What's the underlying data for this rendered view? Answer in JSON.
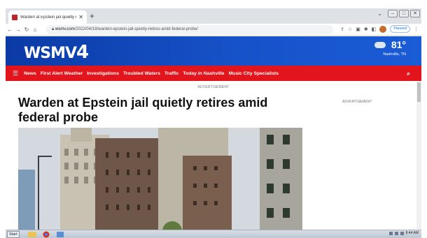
{
  "browser": {
    "tab_title": "Warden at Epstein jail quietly retire",
    "new_tab": "+",
    "url_host": "wsmv.com",
    "url_path": "/2022/04/19/warden-epstein-jail-quietly-retires-amid-federal-probe/",
    "paused_label": "Paused"
  },
  "site": {
    "logo_text": "WSMV",
    "logo_number": "4",
    "weather_temp": "81°",
    "weather_location": "Nashville, TN",
    "nav_items": [
      "News",
      "First Alert Weather",
      "Investigations",
      "Troubled Waters",
      "Traffic",
      "Today in Nashville",
      "Music City Specialists"
    ]
  },
  "article": {
    "ad_label_top": "ADVERTISEMENT",
    "ad_label_right": "ADVERTISEMENT",
    "headline": "Warden at Epstein jail quietly retires amid federal probe"
  },
  "taskbar": {
    "start_label": "Start",
    "clock": "8:44 AM"
  },
  "colors": {
    "brand_blue": "#1652c8",
    "nav_red": "#e2141c"
  }
}
